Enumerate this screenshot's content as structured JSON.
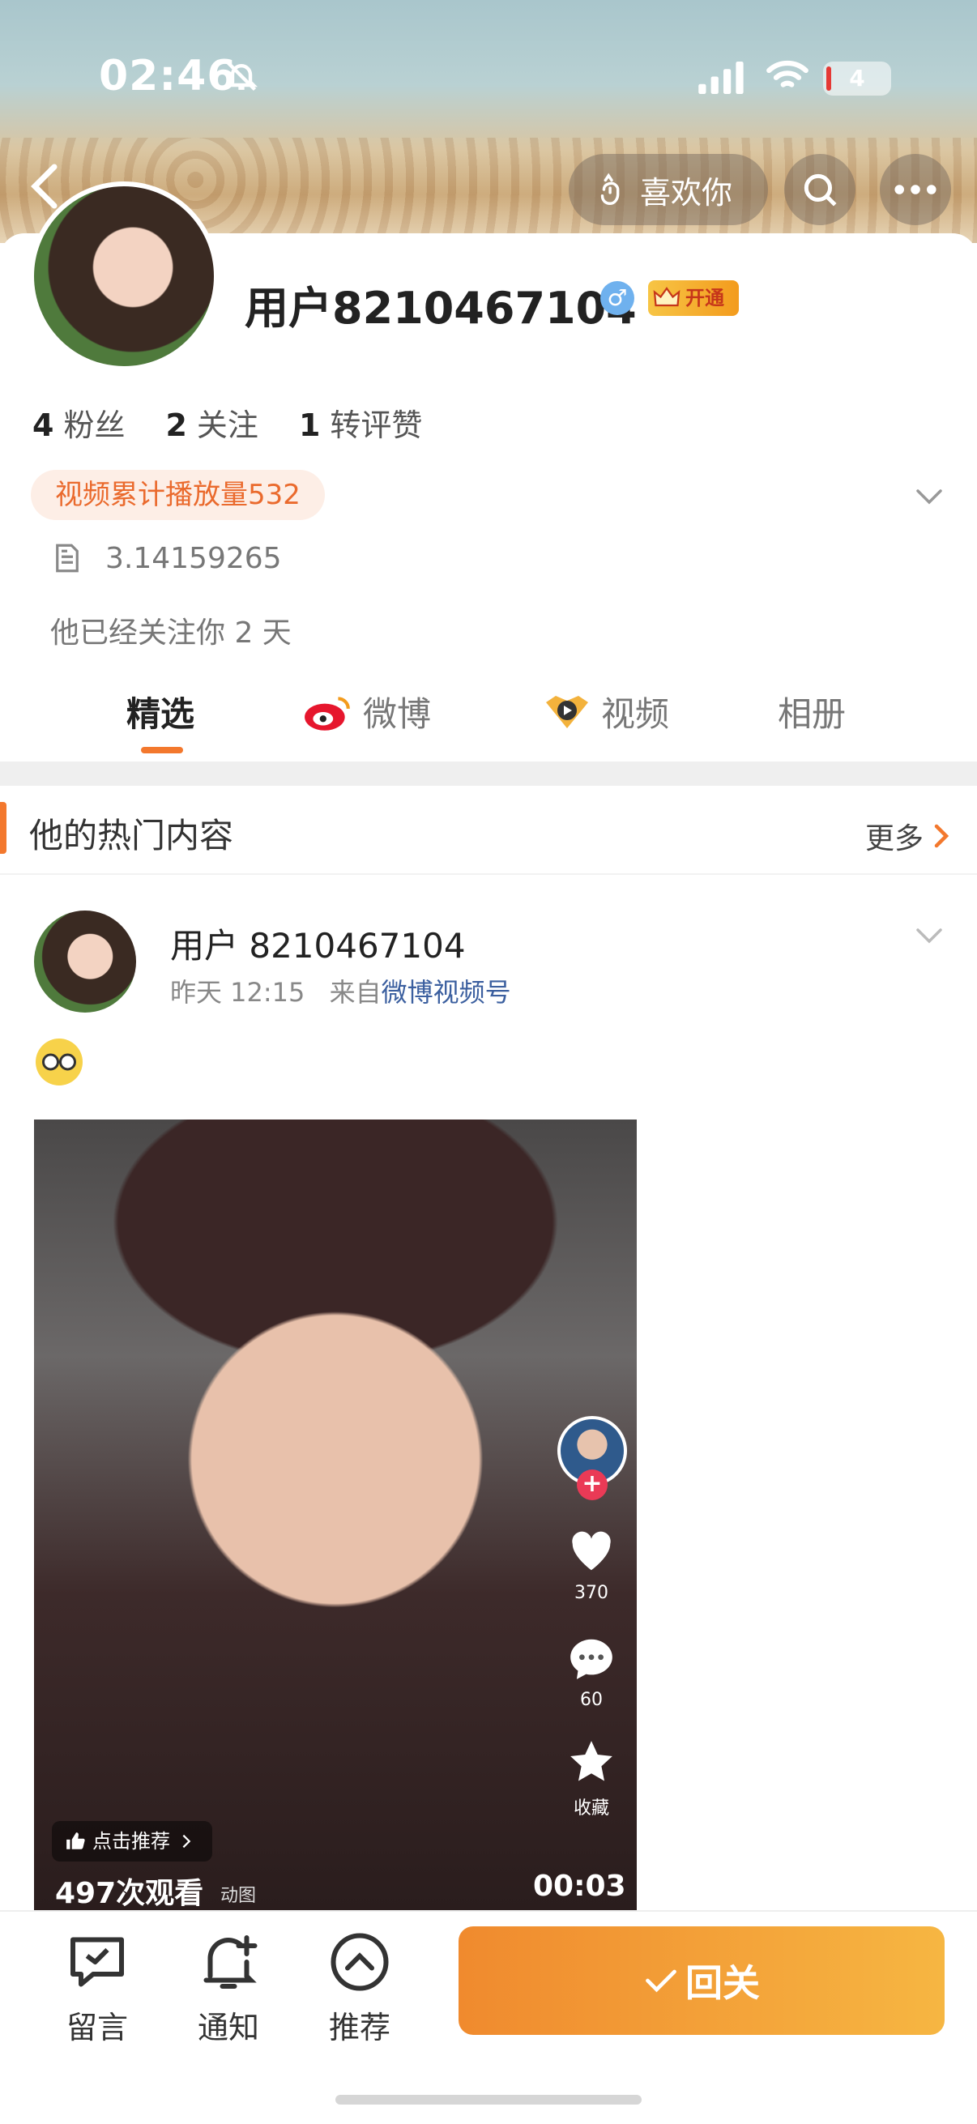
{
  "status_bar": {
    "time": "02:46",
    "battery": "4"
  },
  "header": {
    "like_label": "喜欢你"
  },
  "profile": {
    "username": "用户8210467104",
    "gender_symbol": "♂",
    "vip_label": "开通",
    "stats": [
      {
        "num": "4",
        "label": "粉丝"
      },
      {
        "num": "2",
        "label": "关注"
      },
      {
        "num": "1",
        "label": "转评赞"
      }
    ],
    "video_plays": "视频累计播放量532",
    "bio": "3.14159265",
    "follow_info": "他已经关注你 2 天"
  },
  "tabs": [
    {
      "label": "精选",
      "active": true
    },
    {
      "label": "微博",
      "active": false
    },
    {
      "label": "视频",
      "active": false
    },
    {
      "label": "相册",
      "active": false
    }
  ],
  "hot_section": {
    "title": "他的热门内容",
    "more": "更多"
  },
  "post": {
    "author": "用户 8210467104",
    "time": "昨天 12:15",
    "source_prefix": "来自",
    "source": "微博视频号",
    "video": {
      "likes": "370",
      "comments": "60",
      "favorite_label": "收藏",
      "recommend_label": "点击推荐",
      "views": "497次观看",
      "duration": "00:03",
      "tag": "动图"
    }
  },
  "bottom_bar": {
    "message": "留言",
    "notify": "通知",
    "recommend": "推荐",
    "follow_back": "回关"
  },
  "colors": {
    "accent": "#f3782d",
    "link": "#3b5f9f",
    "follow_gradient_start": "#f08a2e",
    "follow_gradient_end": "#f6b642"
  }
}
